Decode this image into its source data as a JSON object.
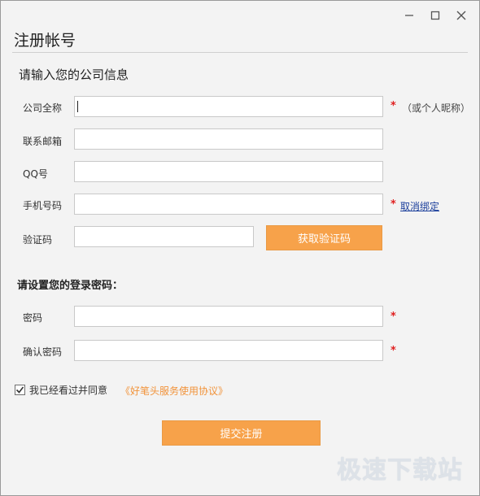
{
  "window": {
    "title": "注册帐号",
    "controls": {
      "minimize": "minimize-icon",
      "maximize": "maximize-icon",
      "close": "close-icon"
    }
  },
  "company_section": {
    "heading": "请输入您的公司信息",
    "fields": {
      "company_name": {
        "label": "公司全称",
        "value": "",
        "required_mark": "*",
        "note": "（或个人昵称）"
      },
      "email": {
        "label": "联系邮箱",
        "value": ""
      },
      "qq": {
        "label": "QQ号",
        "value": ""
      },
      "phone": {
        "label": "手机号码",
        "value": "",
        "required_mark": "*",
        "link": "取消绑定"
      },
      "verify_code": {
        "label": "验证码",
        "value": "",
        "button": "获取验证码"
      }
    }
  },
  "password_section": {
    "heading": "请设置您的登录密码：",
    "fields": {
      "password": {
        "label": "密码",
        "value": "",
        "required_mark": "*"
      },
      "confirm": {
        "label": "确认密码",
        "value": "",
        "required_mark": "*"
      }
    }
  },
  "agreement": {
    "checked": true,
    "text": "我已经看过并同意",
    "link": "《好笔头服务使用协议》"
  },
  "submit_label": "提交注册",
  "watermark": "极速下载站",
  "colors": {
    "accent": "#f7a24a",
    "link": "#1a3e9b",
    "agreement_link": "#f2933a",
    "required": "#e02020"
  }
}
